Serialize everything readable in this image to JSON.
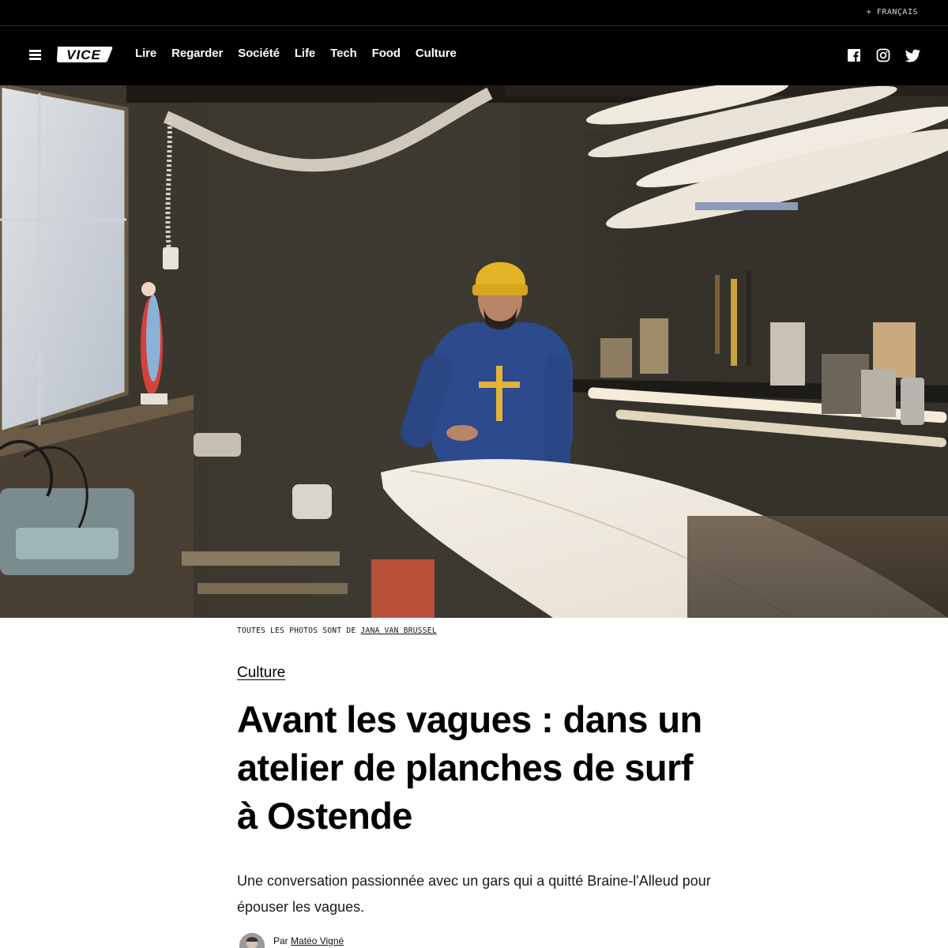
{
  "top_bar": {
    "language_link": "+ FRANÇAIS"
  },
  "nav": {
    "logo_text": "VICE",
    "links": [
      "Lire",
      "Regarder",
      "Société",
      "Life",
      "Tech",
      "Food",
      "Culture"
    ],
    "social": [
      "facebook-icon",
      "instagram-icon",
      "twitter-icon"
    ]
  },
  "hero": {
    "alt": "Surfboard shaper standing in his workshop in Ostende",
    "credit_prefix": "TOUTES LES PHOTOS SONT DE",
    "credit_name": "JANA VAN BRUSSEL"
  },
  "article": {
    "category": "Culture",
    "title": "Avant les vagues : dans un atelier de planches de surf à Ostende",
    "dek": "Une conversation passionnée avec un gars qui a quitté Braine-l'Alleud pour épouser les vagues.",
    "byline_prefix": "Par",
    "author": "Matéo Vigné"
  },
  "colors": {
    "nav_background": "#000000",
    "page_background": "#ffffff",
    "text": "#000000"
  }
}
